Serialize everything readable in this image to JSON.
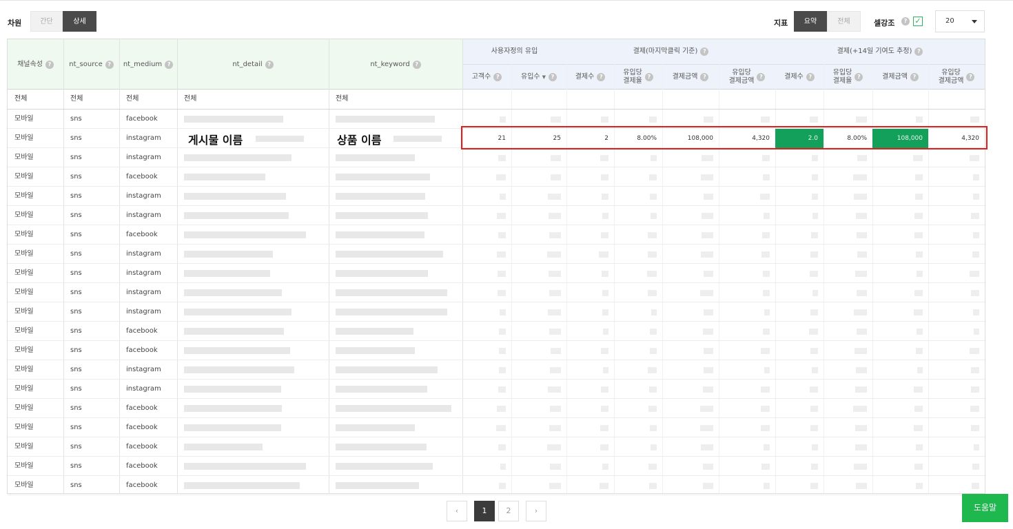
{
  "dimension": {
    "label": "차원",
    "options": [
      "간단",
      "상세"
    ],
    "selected": "상세"
  },
  "metric": {
    "label": "지표",
    "options": [
      "요약",
      "전체"
    ],
    "selected": "요약"
  },
  "emphasis": {
    "label": "셀강조",
    "checked": true
  },
  "page_size": {
    "value": "20"
  },
  "table": {
    "dim_headers": [
      "채널속성",
      "nt_source",
      "nt_medium",
      "nt_detail",
      "nt_keyword"
    ],
    "groups": [
      "사용자정의 유입",
      "결제(마지막클릭 기준)",
      "결제(+14일 기여도 추정)"
    ],
    "metric_headers": [
      "고객수",
      "유입수",
      "결제수",
      "유입당\n결제율",
      "결제금액",
      "유입당\n결제금액",
      "결제수",
      "유입당\n결제율",
      "결제금액",
      "유입당\n결제금액"
    ],
    "all_row": [
      "전체",
      "전체",
      "전체",
      "전체",
      "전체"
    ],
    "rows": [
      {
        "channel": "모바일",
        "source": "sns",
        "medium": "facebook"
      },
      {
        "channel": "모바일",
        "source": "sns",
        "medium": "instagram",
        "detail": "게시물 이름",
        "keyword": "상품 이름",
        "metrics": [
          "21",
          "25",
          "2",
          "8.00%",
          "108,000",
          "4,320",
          "2.0",
          "8.00%",
          "108,000",
          "4,320"
        ]
      },
      {
        "channel": "모바일",
        "source": "sns",
        "medium": "instagram"
      },
      {
        "channel": "모바일",
        "source": "sns",
        "medium": "facebook"
      },
      {
        "channel": "모바일",
        "source": "sns",
        "medium": "instagram"
      },
      {
        "channel": "모바일",
        "source": "sns",
        "medium": "instagram"
      },
      {
        "channel": "모바일",
        "source": "sns",
        "medium": "facebook"
      },
      {
        "channel": "모바일",
        "source": "sns",
        "medium": "instagram"
      },
      {
        "channel": "모바일",
        "source": "sns",
        "medium": "instagram"
      },
      {
        "channel": "모바일",
        "source": "sns",
        "medium": "instagram"
      },
      {
        "channel": "모바일",
        "source": "sns",
        "medium": "instagram"
      },
      {
        "channel": "모바일",
        "source": "sns",
        "medium": "facebook"
      },
      {
        "channel": "모바일",
        "source": "sns",
        "medium": "facebook"
      },
      {
        "channel": "모바일",
        "source": "sns",
        "medium": "instagram"
      },
      {
        "channel": "모바일",
        "source": "sns",
        "medium": "instagram"
      },
      {
        "channel": "모바일",
        "source": "sns",
        "medium": "facebook"
      },
      {
        "channel": "모바일",
        "source": "sns",
        "medium": "facebook"
      },
      {
        "channel": "모바일",
        "source": "sns",
        "medium": "facebook"
      },
      {
        "channel": "모바일",
        "source": "sns",
        "medium": "facebook"
      },
      {
        "channel": "모바일",
        "source": "sns",
        "medium": "facebook"
      }
    ]
  },
  "pagination": {
    "prev": "‹",
    "pages": [
      "1",
      "2"
    ],
    "current": "1",
    "next": "›"
  },
  "help_label": "도움말",
  "colors": {
    "highlight_border": "#e01c1c",
    "emphasis_green": "#13a05a",
    "help_button": "#1fb84f"
  }
}
